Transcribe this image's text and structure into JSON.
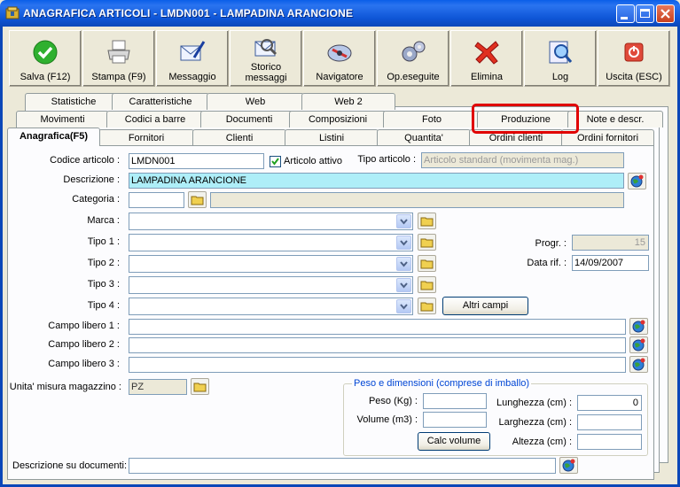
{
  "window": {
    "title": "ANAGRAFICA ARTICOLI - LMDN001 - LAMPADINA ARANCIONE"
  },
  "toolbar": {
    "buttons": [
      {
        "label": "Salva (F12)",
        "icon": "check-icon"
      },
      {
        "label": "Stampa (F9)",
        "icon": "printer-icon"
      },
      {
        "label": "Messaggio",
        "icon": "message-icon"
      },
      {
        "label": "Storico messaggi",
        "label1": "Storico",
        "label2": "messaggi",
        "icon": "history-icon"
      },
      {
        "label": "Navigatore",
        "icon": "navigator-icon"
      },
      {
        "label": "Op.eseguite",
        "icon": "gears-icon"
      },
      {
        "label": "Elimina",
        "icon": "delete-icon"
      },
      {
        "label": "Log",
        "icon": "log-icon"
      },
      {
        "label": "Uscita (ESC)",
        "icon": "exit-icon"
      }
    ]
  },
  "tabs": {
    "row1": [
      "Statistiche",
      "Caratteristiche",
      "Web",
      "Web 2"
    ],
    "row2": [
      "Movimenti",
      "Codici a barre",
      "Documenti",
      "Composizioni",
      "Foto",
      "Produzione",
      "Note e descr."
    ],
    "row3": [
      "Anagrafica(F5)",
      "Fornitori",
      "Clienti",
      "Listini",
      "Quantita'",
      "Ordini clienti",
      "Ordini fornitori"
    ],
    "highlighted": "Produzione"
  },
  "form": {
    "codice_label": "Codice articolo :",
    "codice_value": "LMDN001",
    "attivo_label": "Articolo attivo",
    "tipo_articolo_label": "Tipo articolo :",
    "tipo_articolo_value": "Articolo standard (movimenta mag.)",
    "descrizione_label": "Descrizione :",
    "descrizione_value": "LAMPADINA ARANCIONE",
    "categoria_label": "Categoria :",
    "marca_label": "Marca :",
    "tipo1_label": "Tipo 1 :",
    "tipo2_label": "Tipo 2 :",
    "tipo3_label": "Tipo 3 :",
    "tipo4_label": "Tipo 4 :",
    "altri_campi": "Altri campi",
    "progr_label": "Progr. :",
    "progr_value": "15",
    "data_rif_label": "Data rif. :",
    "data_rif_value": "14/09/2007",
    "campo1_label": "Campo libero 1 :",
    "campo2_label": "Campo libero 2 :",
    "campo3_label": "Campo libero 3 :",
    "um_label": "Unita' misura magazzino :",
    "um_value": "PZ",
    "peso_group": "Peso e dimensioni (comprese di imballo)",
    "peso_label": "Peso (Kg) :",
    "volume_label": "Volume (m3) :",
    "calc_volume": "Calc volume",
    "lunghezza_label": "Lunghezza (cm) :",
    "lunghezza_value": "0",
    "larghezza_label": "Larghezza (cm) :",
    "altezza_label": "Altezza (cm) :",
    "desc_doc_label": "Descrizione su documenti:"
  },
  "colors": {
    "titlebar": "#0a5ee8",
    "highlight": "#e00000",
    "description_bg": "#aeeef8"
  }
}
